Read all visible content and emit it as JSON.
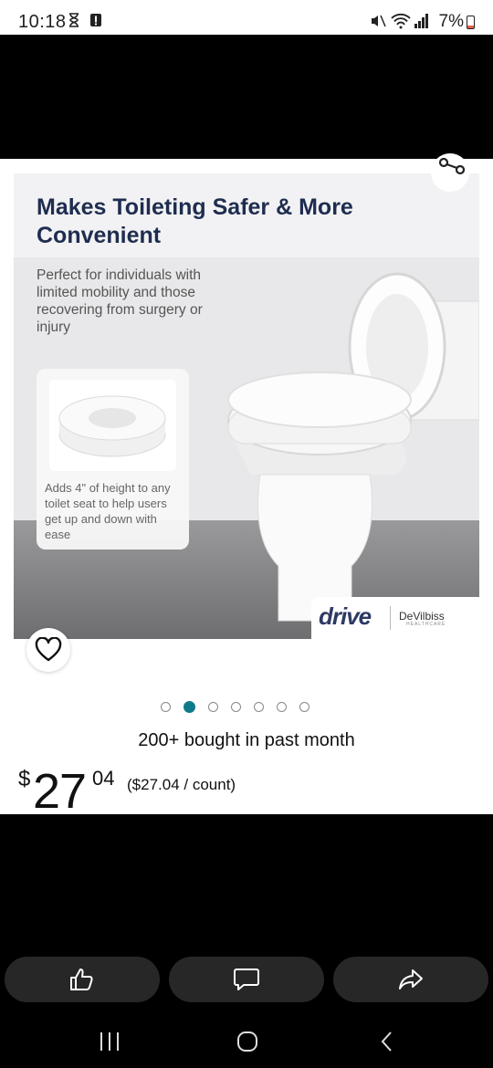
{
  "status_bar": {
    "time": "10:18",
    "battery_percent": "7%"
  },
  "product_image": {
    "heading": "Makes Toileting Safer & More Convenient",
    "subtext": "Perfect for individuals with limited mobility and those recovering from surgery or injury",
    "info_caption": "Adds 4\" of height to any toilet seat to help users get up and down with ease",
    "brand_logo": "drive",
    "partner_logo": "DeVilbiss",
    "partner_sub": "HEALTHCARE"
  },
  "carousel": {
    "total_images": 7,
    "active_index": 1
  },
  "product": {
    "bought_text": "200+ bought in past month",
    "price_currency": "$",
    "price_whole": "27",
    "price_fraction": "04",
    "unit_price": "($27.04 / count)"
  },
  "icons": {
    "share": "share-icon",
    "wishlist": "heart-icon",
    "like": "thumbs-up-icon",
    "comment": "comment-icon",
    "forward": "share-arrow-icon",
    "recents": "recents-icon",
    "home": "home-icon",
    "back": "back-icon"
  },
  "colors": {
    "accent_dot": "#0f7a8a",
    "heading": "#1e2d4f",
    "action_bg": "#272727"
  }
}
